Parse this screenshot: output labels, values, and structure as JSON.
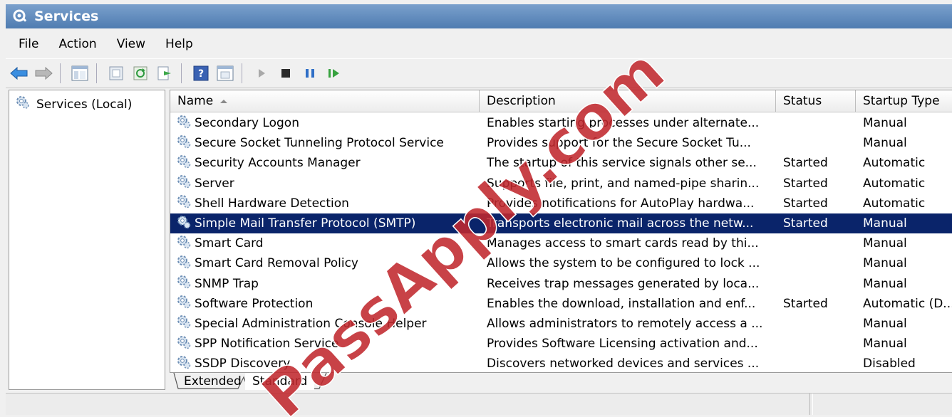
{
  "window": {
    "title": "Services"
  },
  "menu": [
    {
      "label": "File"
    },
    {
      "label": "Action"
    },
    {
      "label": "View"
    },
    {
      "label": "Help"
    }
  ],
  "tree": {
    "root": "Services (Local)"
  },
  "table": {
    "columns": [
      "Name",
      "Description",
      "Status",
      "Startup Type"
    ],
    "sort": {
      "column": "Name",
      "direction": "ascending"
    },
    "rows": [
      {
        "name": "Secondary Logon",
        "description": "Enables starting processes under alternate...",
        "status": "",
        "startup": "Manual",
        "selected": false
      },
      {
        "name": "Secure Socket Tunneling Protocol Service",
        "description": "Provides support for the Secure Socket Tu...",
        "status": "",
        "startup": "Manual",
        "selected": false
      },
      {
        "name": "Security Accounts Manager",
        "description": "The startup of this service signals other se...",
        "status": "Started",
        "startup": "Automatic",
        "selected": false
      },
      {
        "name": "Server",
        "description": "Supports file, print, and named-pipe sharin...",
        "status": "Started",
        "startup": "Automatic",
        "selected": false
      },
      {
        "name": "Shell Hardware Detection",
        "description": "Provides notifications for AutoPlay hardwa...",
        "status": "Started",
        "startup": "Automatic",
        "selected": false
      },
      {
        "name": "Simple Mail Transfer Protocol (SMTP)",
        "description": "Transports electronic mail across the netw...",
        "status": "Started",
        "startup": "Manual",
        "selected": true
      },
      {
        "name": "Smart Card",
        "description": "Manages access to smart cards read by thi...",
        "status": "",
        "startup": "Manual",
        "selected": false
      },
      {
        "name": "Smart Card Removal Policy",
        "description": "Allows the system to be configured to lock ...",
        "status": "",
        "startup": "Manual",
        "selected": false
      },
      {
        "name": "SNMP Trap",
        "description": "Receives trap messages generated by loca...",
        "status": "",
        "startup": "Manual",
        "selected": false
      },
      {
        "name": "Software Protection",
        "description": "Enables the download, installation and enf...",
        "status": "Started",
        "startup": "Automatic (D...",
        "selected": false
      },
      {
        "name": "Special Administration Console Helper",
        "description": "Allows administrators to remotely access a ...",
        "status": "",
        "startup": "Manual",
        "selected": false
      },
      {
        "name": "SPP Notification Service",
        "description": "Provides Software Licensing activation and...",
        "status": "",
        "startup": "Manual",
        "selected": false
      },
      {
        "name": "SSDP Discovery",
        "description": "Discovers networked devices and services ...",
        "status": "",
        "startup": "Disabled",
        "selected": false
      }
    ]
  },
  "tabs": [
    {
      "label": "Extended",
      "active": false
    },
    {
      "label": "Standard",
      "active": true
    }
  ],
  "watermark": {
    "text": "PassApply.com",
    "color": "#c0282d"
  },
  "colors": {
    "selection": "#0a246a",
    "titlebar": "#4f7cb1"
  },
  "toolbar_icons": [
    "back-arrow-icon",
    "forward-arrow-icon",
    "show-hide-console-tree-icon",
    "properties-icon",
    "refresh-icon",
    "export-list-icon",
    "help-icon",
    "view-icon",
    "start-service-icon",
    "stop-service-icon",
    "pause-service-icon",
    "resume-service-icon"
  ]
}
